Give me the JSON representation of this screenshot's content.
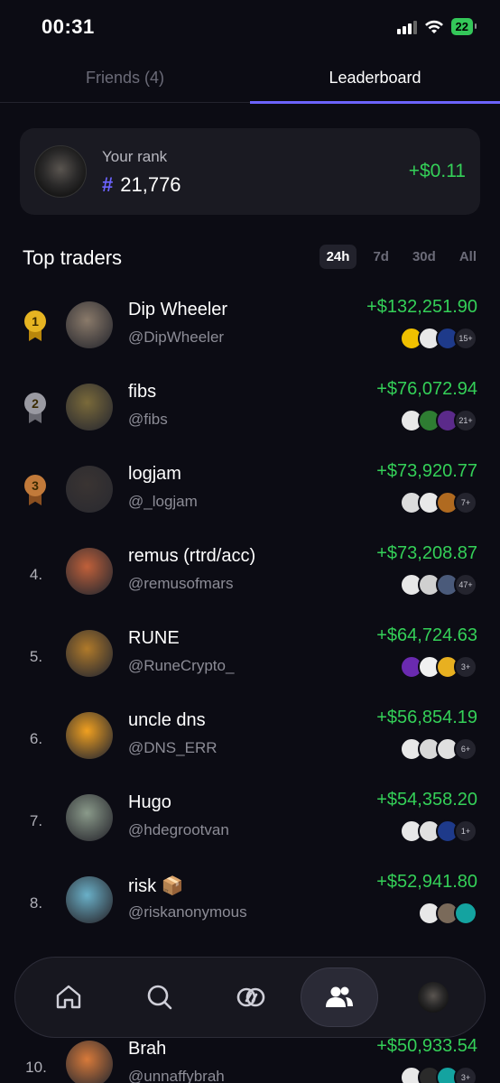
{
  "status_bar": {
    "time": "00:31",
    "battery": "22"
  },
  "tabs": {
    "friends": "Friends (4)",
    "leaderboard": "Leaderboard"
  },
  "your_rank": {
    "label": "Your rank",
    "hash": "#",
    "value": "21,776",
    "pnl": "+$0.11"
  },
  "section": {
    "title": "Top traders"
  },
  "periods": [
    "24h",
    "7d",
    "30d",
    "All"
  ],
  "traders": [
    {
      "rank": "1",
      "name": "Dip Wheeler",
      "handle": "@DipWheeler",
      "pnl": "+$132,251.90",
      "more": "15+",
      "medal_color": "#e6b422",
      "ribbon_color": "#b8860b",
      "avatar_color": "#8a7a6a",
      "token_colors": [
        "#f0c000",
        "#e8e8e8",
        "#1e3a8a"
      ]
    },
    {
      "rank": "2",
      "name": "fibs",
      "handle": "@fibs",
      "pnl": "+$76,072.94",
      "more": "21+",
      "medal_color": "#9a9aa2",
      "ribbon_color": "#6a6a72",
      "avatar_color": "#7a6a3a",
      "token_colors": [
        "#e8e8e8",
        "#2e7d32",
        "#5b2a8a"
      ]
    },
    {
      "rank": "3",
      "name": "logjam",
      "handle": "@_logjam",
      "pnl": "+$73,920.77",
      "more": "7+",
      "medal_color": "#c27a3a",
      "ribbon_color": "#8a4f20",
      "avatar_color": "#3a3432",
      "token_colors": [
        "#dcdcdc",
        "#e8e8e8",
        "#b06a20"
      ]
    },
    {
      "rank": "4.",
      "name": "remus (rtrd/acc)",
      "handle": "@remusofmars",
      "pnl": "+$73,208.87",
      "more": "47+",
      "medal_color": "",
      "ribbon_color": "",
      "avatar_color": "#c0603a",
      "token_colors": [
        "#e8e8e8",
        "#d0d0d0",
        "#4a5a7a"
      ]
    },
    {
      "rank": "5.",
      "name": "RUNE",
      "handle": "@RuneCrypto_",
      "pnl": "+$64,724.63",
      "more": "3+",
      "medal_color": "",
      "ribbon_color": "",
      "avatar_color": "#b07a2a",
      "token_colors": [
        "#6a2ab0",
        "#f0f0f0",
        "#e8b020"
      ]
    },
    {
      "rank": "6.",
      "name": "uncle dns",
      "handle": "@DNS_ERR",
      "pnl": "+$56,854.19",
      "more": "6+",
      "medal_color": "",
      "ribbon_color": "",
      "avatar_color": "#f0a020",
      "token_colors": [
        "#e8e8e8",
        "#d8d8d8",
        "#e0e0e0"
      ]
    },
    {
      "rank": "7.",
      "name": "Hugo",
      "handle": "@hdegrootvan",
      "pnl": "+$54,358.20",
      "more": "1+",
      "medal_color": "",
      "ribbon_color": "",
      "avatar_color": "#8a9a8a",
      "token_colors": [
        "#e8e8e8",
        "#e0e0e0",
        "#1e3a8a"
      ]
    },
    {
      "rank": "8.",
      "name": "risk 📦",
      "handle": "@riskanonymous",
      "pnl": "+$52,941.80",
      "more": "",
      "medal_color": "",
      "ribbon_color": "",
      "avatar_color": "#6ab0c8",
      "token_colors": [
        "#e8e8e8",
        "#7a6a5a",
        "#14a3a0"
      ]
    },
    {
      "rank": "10.",
      "name": "Brah",
      "handle": "@unnaffybrah",
      "pnl": "+$50,933.54",
      "more": "3+",
      "medal_color": "",
      "ribbon_color": "",
      "avatar_color": "#d87a3a",
      "token_colors": [
        "#e8e8e8",
        "#2a2a2a",
        "#14a3a0"
      ]
    }
  ],
  "colors": {
    "accent": "#6c63ff",
    "positive": "#34d058",
    "background": "#0c0c14"
  },
  "nav": [
    "home-icon",
    "search-icon",
    "trade-icon",
    "friends-icon",
    "profile-avatar"
  ]
}
